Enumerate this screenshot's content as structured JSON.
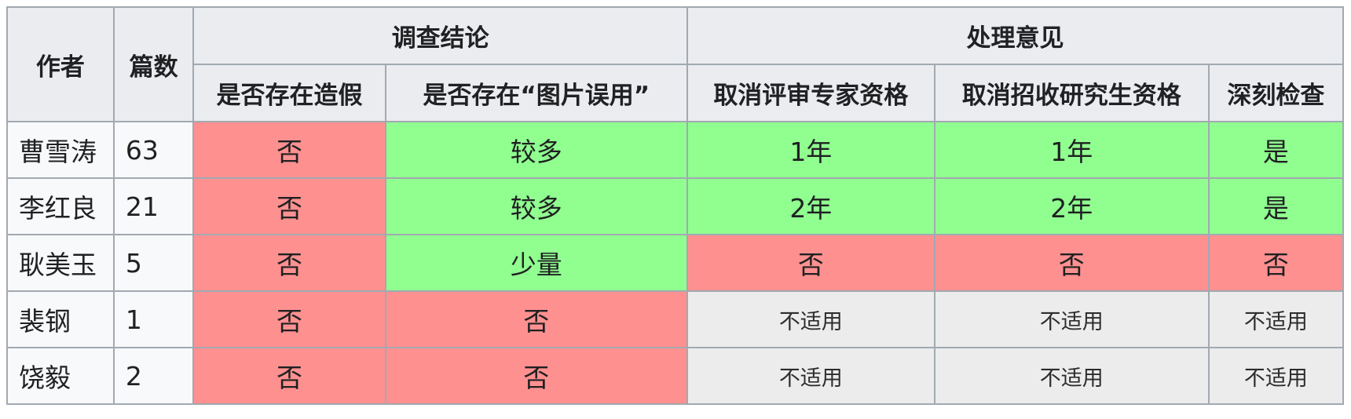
{
  "colors": {
    "header_bg": "#eaecf0",
    "border": "#a2a9b1",
    "red_cell": "#ff9090",
    "green_cell": "#90ff90",
    "na_cell": "#ececec"
  },
  "headers": {
    "author": "作者",
    "count": "篇数",
    "group_investigation": "调查结论",
    "group_handling": "处理意见",
    "fabrication": "是否存在造假",
    "image_misuse": "是否存在“图片误用”",
    "revoke_reviewer": "取消评审专家资格",
    "revoke_supervisor": "取消招收研究生资格",
    "self_review": "深刻检查"
  },
  "rows": [
    {
      "author": "曹雪涛",
      "count": "63",
      "fabrication": "否",
      "image_misuse": "较多",
      "revoke_reviewer": "1年",
      "revoke_supervisor": "1年",
      "self_review": "是"
    },
    {
      "author": "李红良",
      "count": "21",
      "fabrication": "否",
      "image_misuse": "较多",
      "revoke_reviewer": "2年",
      "revoke_supervisor": "2年",
      "self_review": "是"
    },
    {
      "author": "耿美玉",
      "count": "5",
      "fabrication": "否",
      "image_misuse": "少量",
      "revoke_reviewer": "否",
      "revoke_supervisor": "否",
      "self_review": "否"
    },
    {
      "author": "裴钢",
      "count": "1",
      "fabrication": "否",
      "image_misuse": "否",
      "revoke_reviewer": "不适用",
      "revoke_supervisor": "不适用",
      "self_review": "不适用"
    },
    {
      "author": "饶毅",
      "count": "2",
      "fabrication": "否",
      "image_misuse": "否",
      "revoke_reviewer": "不适用",
      "revoke_supervisor": "不适用",
      "self_review": "不适用"
    }
  ]
}
